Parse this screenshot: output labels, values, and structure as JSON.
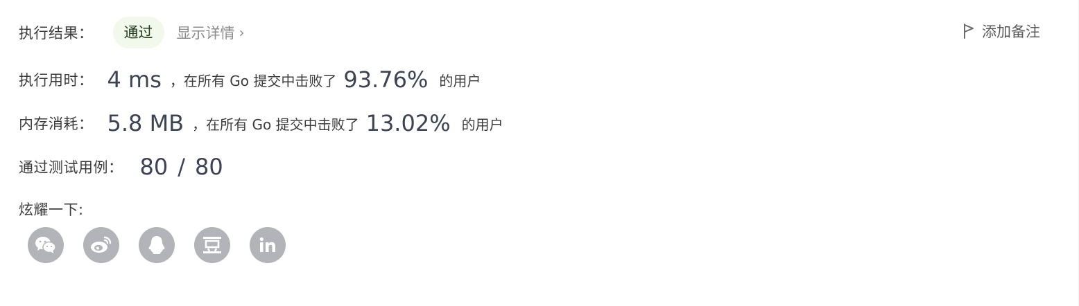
{
  "result": {
    "label": "执行结果：",
    "status": "通过",
    "details_link": "显示详情",
    "details_chevron": "›"
  },
  "add_note": {
    "label": "添加备注",
    "icon": "flag-icon"
  },
  "runtime": {
    "label": "执行用时：",
    "value": "4 ms",
    "middle_text": "，在所有 Go 提交中击败了",
    "percent": "93.76%",
    "suffix": "的用户"
  },
  "memory": {
    "label": "内存消耗：",
    "value": "5.8 MB",
    "middle_text": "，在所有 Go 提交中击败了",
    "percent": "13.02%",
    "suffix": "的用户"
  },
  "testcases": {
    "label": "通过测试用例：",
    "passed": "80",
    "separator": "/",
    "total": "80"
  },
  "share": {
    "label": "炫耀一下:",
    "icons": [
      "wechat-icon",
      "weibo-icon",
      "qq-icon",
      "douban-icon",
      "linkedin-icon"
    ],
    "icon_bg": "#b2b4b9"
  },
  "colors": {
    "badge_bg": "#f2f9ec",
    "badge_text": "#1f3b1a",
    "big_number": "#3c4453",
    "muted": "#8c8c8c"
  }
}
